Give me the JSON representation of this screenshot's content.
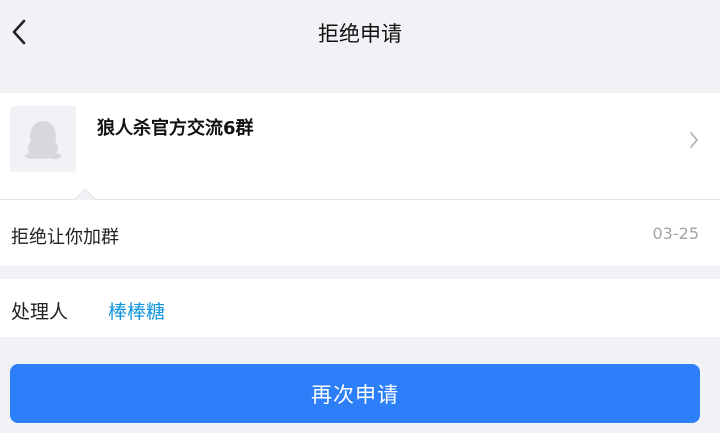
{
  "header": {
    "title": "拒绝申请",
    "back_icon": "chevron-left-icon"
  },
  "group": {
    "name": "狼人杀官方交流6群",
    "avatar_icon": "qq-penguin-icon"
  },
  "reason": {
    "text": "拒绝让你加群",
    "date": "03-25"
  },
  "handler": {
    "label": "处理人",
    "name": "棒棒糖",
    "name_color": "#1296db"
  },
  "action": {
    "reapply_label": "再次申请",
    "button_color": "#2d7ff9"
  }
}
